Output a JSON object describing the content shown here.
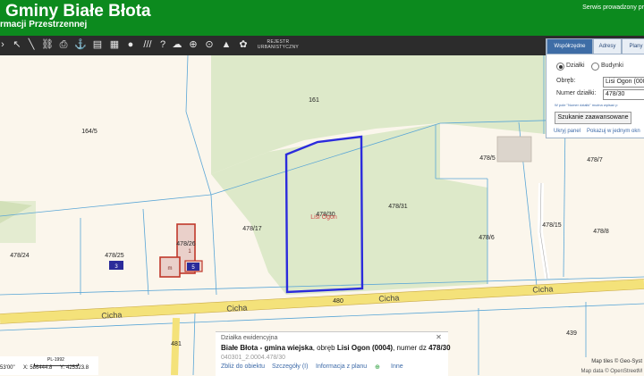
{
  "header": {
    "title": "Gminy Białe Błota",
    "subtitle": "rmacji Przestrzennej",
    "service_note": "Serwis prowadzony pr"
  },
  "toolbar": {
    "registry_label": "REJESTR URBANISTYCZNY",
    "icons": [
      "pan-icon",
      "measure-line-icon",
      "measure-area-icon",
      "print-icon",
      "anchor-icon",
      "layers-icon",
      "comment-icon",
      "hatch-icon",
      "help-icon",
      "cloud-icon",
      "search-zoom-icon",
      "magnify-icon",
      "triangle-icon",
      "tools-icon"
    ]
  },
  "panel": {
    "tabs": [
      "Współrzędne",
      "Adresy",
      "Plany"
    ],
    "radio_dzialki": "Działki",
    "radio_budynki": "Budynki",
    "obreb_label": "Obręb:",
    "obreb_value": "Lisi Ogon (000",
    "numer_label": "Numer działki:",
    "numer_value": "478/30",
    "hint": "W pole \"Numer działki\" można wpisać p",
    "advanced_button": "Szukanie zaawansowane",
    "hide_link": "Ukryj panel",
    "show_link": "Pokazuj w jednym okn"
  },
  "map": {
    "parcels": [
      "161",
      "164/5",
      "478/5",
      "478/7",
      "478/30",
      "478/31",
      "478/17",
      "478/24",
      "478/25",
      "478/26",
      "478/6",
      "478/15",
      "478/8",
      "480",
      "439",
      "481"
    ],
    "place_label": "Lisi Ogon",
    "street": "Cicha",
    "building_numbers": [
      "3",
      "5",
      "1",
      "m"
    ]
  },
  "popup": {
    "heading": "Działka ewidencyjna",
    "desc_gmina": "Białe Błota - gmina wiejska",
    "desc_obreb_prefix": ", obręb ",
    "desc_obreb": "Lisi Ogon (0004)",
    "desc_numer_prefix": ", numer dz ",
    "desc_numer": "478/30",
    "code": "040301_2.0004.478/30",
    "links": [
      "Zbliż do obiektu",
      "Szczegóły (I)",
      "Informacja z planu",
      "Inne"
    ]
  },
  "status": {
    "scale_label": "PL-1992",
    "coord_left": "53'00\"",
    "x_value": "X: 586444.8",
    "y_value": "Y: 425323.8"
  },
  "attribution": {
    "line1": "Map tiles © Geo-Syst",
    "line2": "Map data © OpenStreetM"
  },
  "colors": {
    "header_green": "#0c8a1e",
    "selected_parcel": "#2b2bdc",
    "road_yellow": "#f4e27a",
    "forest_green": "#dde9c9",
    "building_red": "#c0392b"
  }
}
